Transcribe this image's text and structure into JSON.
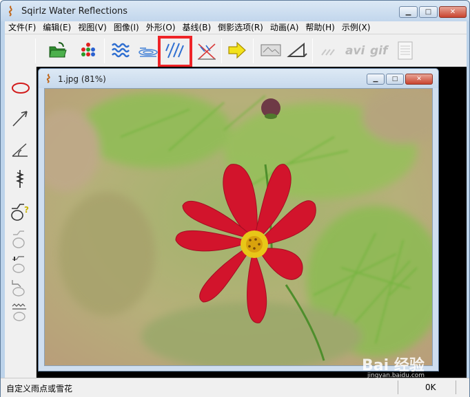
{
  "window": {
    "title": "Sqirlz Water Reflections",
    "controls": {
      "minimize": "▁",
      "maximize": "□",
      "close": "✕"
    }
  },
  "menu": [
    "文件(F)",
    "编辑(E)",
    "视图(V)",
    "图像(I)",
    "外形(O)",
    "基线(B)",
    "倒影选项(R)",
    "动画(A)",
    "帮助(H)",
    "示例(X)"
  ],
  "toolbar": {
    "buttons": [
      "open-folder-icon",
      "color-dots-icon",
      "ripple-waves-icon",
      "ellipse-ripple-icon",
      "rain-streaks-icon",
      "mask-cross-icon",
      "arrow-right-icon",
      "image-frame-icon",
      "triangle-ruler-icon",
      "wind-lines-icon",
      "avi-export-icon",
      "gif-export-icon",
      "page-icon"
    ],
    "text_icons": {
      "avi": "avi",
      "gif": "gif"
    },
    "highlighted": "rain-streaks-icon",
    "highlight_color": "#ef2327"
  },
  "left_tools": [
    "ellipse-tool-icon",
    "arrow-tool-icon",
    "angle-tool-icon",
    "baseline-tool-icon",
    "reflection-question-icon",
    "reflection-tool-2-icon",
    "reflection-tool-3-icon",
    "reflection-tool-4-icon",
    "reflection-tool-5-icon"
  ],
  "document": {
    "title": "1.jpg   (81%)",
    "controls": {
      "minimize": "▁",
      "maximize": "□",
      "close": "✕"
    }
  },
  "status": {
    "left": "自定义雨点或雪花",
    "right": "0K"
  },
  "watermark": {
    "main": "Bai 经验",
    "sub": "jingyan.baidu.com"
  },
  "colors": {
    "chrome": "#bcd3ea",
    "panel": "#f0f0f0",
    "flower": "#d2142c",
    "highlight": "#ef2327"
  }
}
